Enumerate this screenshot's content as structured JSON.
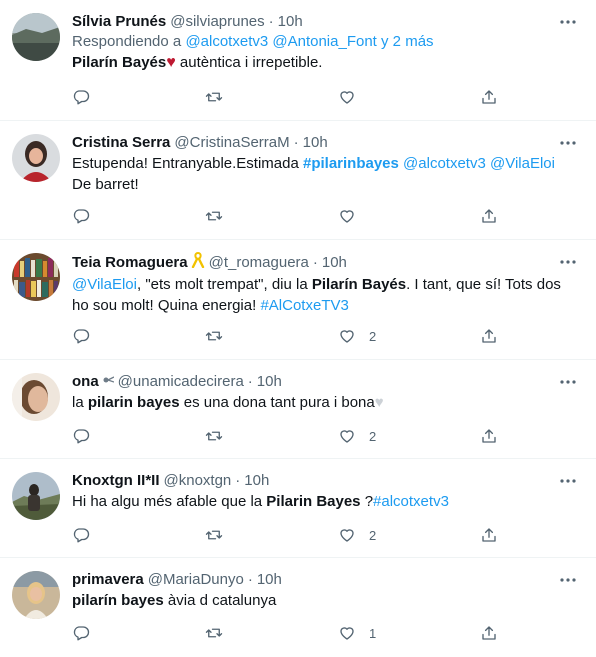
{
  "colors": {
    "link": "#1d9bf0",
    "secondary": "#536471",
    "text": "#0f1419",
    "divider": "#eff3f4"
  },
  "tweets": [
    {
      "name": "Sílvia Prunés",
      "handle": "@silviaprunes",
      "time": "10h",
      "reply": {
        "prefix": "Respondiendo a",
        "mention1": "@alcotxetv3",
        "mention2": "@Antonia_Font",
        "suffix": "y 2 más"
      },
      "text": {
        "bold": "Pilarín Bayés",
        "emoji": "heart",
        "rest": "autèntica i irrepetible."
      },
      "replies": "",
      "retweets": "",
      "likes": ""
    },
    {
      "name": "Cristina Serra",
      "handle": "@CristinaSerraM",
      "time": "10h",
      "text": {
        "plain": "Estupenda! Entranyable.Estimada",
        "hashtag": "#pilarinbayes",
        "mention1": "@alcotxetv3",
        "mention2": "@VilaEloi",
        "tail": "De barret!"
      },
      "replies": "",
      "retweets": "",
      "likes": ""
    },
    {
      "name": "Teia Romaguera",
      "name_emoji": "yellow-ribbon",
      "handle": "@t_romaguera",
      "time": "10h",
      "text": {
        "mention": "@VilaEloi",
        "part1": ", \"ets molt trempat\", diu la",
        "bold": "Pilarín Bayés",
        "part2": ". I tant, que sí! Tots dos ho sou molt! Quina energia!",
        "hashtag": "#AlCotxeTV3"
      },
      "replies": "",
      "retweets": "",
      "likes": "2"
    },
    {
      "name": "ona",
      "name_emoji": "flower",
      "handle": "@unamicadecirera",
      "time": "10h",
      "text": {
        "part1": "la",
        "bold": "pilarin bayes",
        "part2": "es una dona tant pura i bona",
        "emoji": "white-heart"
      },
      "replies": "",
      "retweets": "",
      "likes": "2"
    },
    {
      "name": "Knoxtgn II*II",
      "handle": "@knoxtgn",
      "time": "10h",
      "text": {
        "part1": "Hi ha algu més afable que la",
        "bold": "Pilarin Bayes",
        "part2": "?",
        "hashtag": "#alcotxetv3"
      },
      "replies": "",
      "retweets": "",
      "likes": "2"
    },
    {
      "name": "primavera",
      "handle": "@MariaDunyo",
      "time": "10h",
      "text": {
        "bold": "pilarín bayes",
        "part2": "àvia d catalunya"
      },
      "replies": "",
      "retweets": "",
      "likes": "1"
    }
  ]
}
